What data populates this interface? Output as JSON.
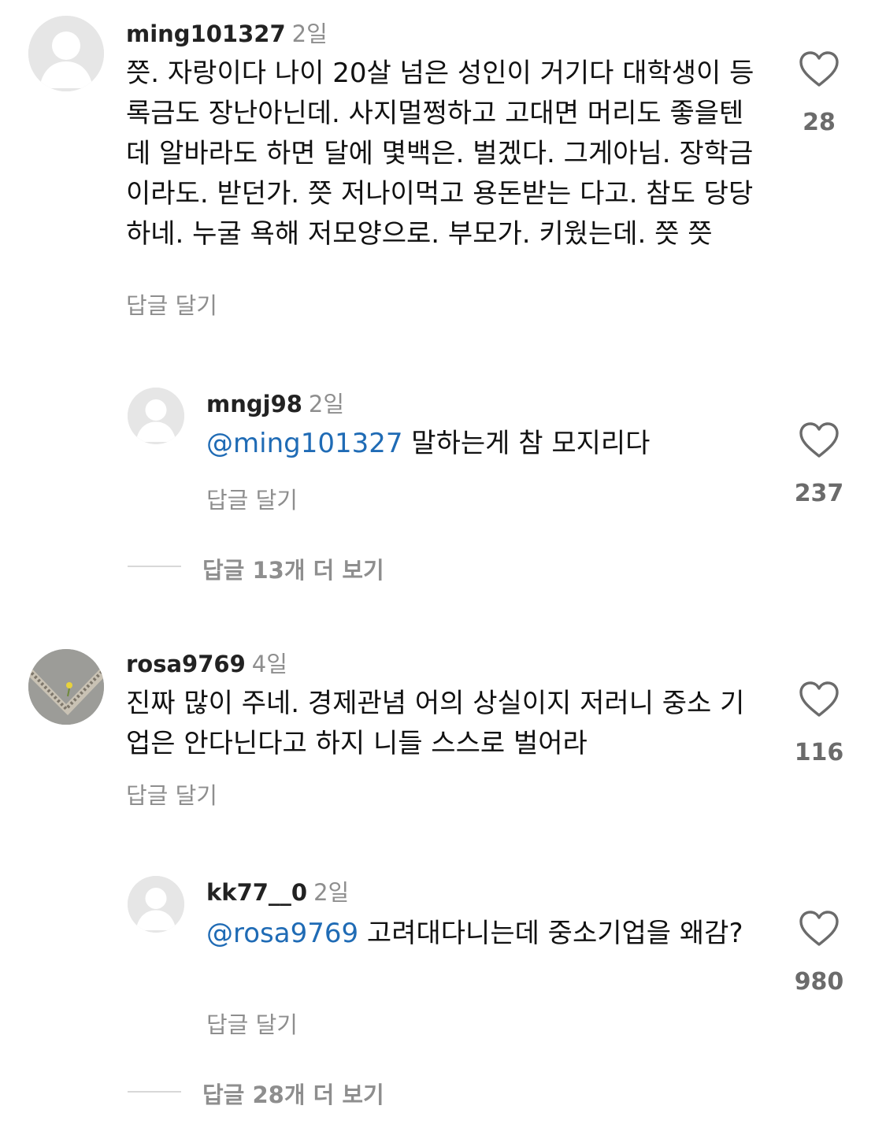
{
  "comments": [
    {
      "username": "ming101327",
      "time": "2일",
      "text": "쯧. 자랑이다  나이 20살 넘은 성인이 거기다 대학생이 등록금도 장난아닌데. 사지멀쩡하고 고대면 머리도 좋을텐데 알바라도 하면 달에 몇백은. 벌겠다. 그게아님. 장학금이라도. 받던가. 쯧 저나이먹고 용돈받는 다고. 참도 당당 하네.  누굴 욕해 저모양으로. 부모가. 키웠는데. 쯧 쯧",
      "likes": "28",
      "reply_label": "답글 달기",
      "reply": {
        "username": "mngj98",
        "time": "2일",
        "mention": "@ming101327",
        "text": " 말하는게 참 모지리다",
        "likes": "237",
        "reply_label": "답글 달기"
      },
      "more_replies": "답글 13개 더 보기"
    },
    {
      "username": "rosa9769",
      "time": "4일",
      "text": "진짜 많이 주네. 경제관념 어의 상실이지 저러니  중소 기업은 안다닌다고 하지 니들 스스로 벌어라",
      "likes": "116",
      "reply_label": "답글 달기",
      "reply": {
        "username": "kk77__0",
        "time": "2일",
        "mention": "@rosa9769",
        "text": " 고려대다니는데 중소기업을 왜감?",
        "likes": "980",
        "reply_label": "답글 달기"
      },
      "more_replies": "답글 28개 더 보기"
    }
  ],
  "icons": {
    "like": "heart-outline-icon",
    "avatar": "default-avatar-icon"
  }
}
